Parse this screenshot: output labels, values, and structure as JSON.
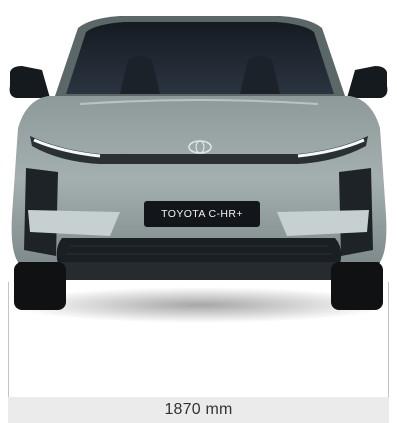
{
  "vehicle": {
    "plate_text": "TOYOTA C-HR+",
    "body_color": "#9aa6a6"
  },
  "dimension": {
    "width_label": "1870 mm"
  },
  "colors": {
    "background": "#ffffff",
    "dimension_bar": "#ebebeb",
    "dimension_text": "#333333"
  }
}
